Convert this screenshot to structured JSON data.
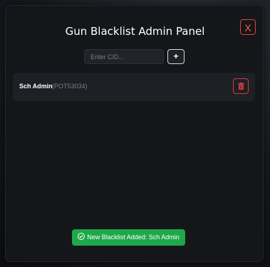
{
  "panel": {
    "title": "Gun Blacklist Admin Panel",
    "close_label": "X"
  },
  "form": {
    "cid_placeholder": "Enter CID...",
    "cid_value": "",
    "add_label": "+"
  },
  "blacklist": {
    "entries": [
      {
        "name": "Sch Admin",
        "cid": "(POT53034)",
        "delete_icon": "trash-icon"
      }
    ]
  },
  "toast": {
    "message": "New Blacklist Added: Sch Admin",
    "icon": "check-circle-icon",
    "color": "#1fa84a"
  },
  "colors": {
    "accent_danger": "#e0423f",
    "panel_bg": "#141619",
    "row_bg": "#1d2025"
  }
}
